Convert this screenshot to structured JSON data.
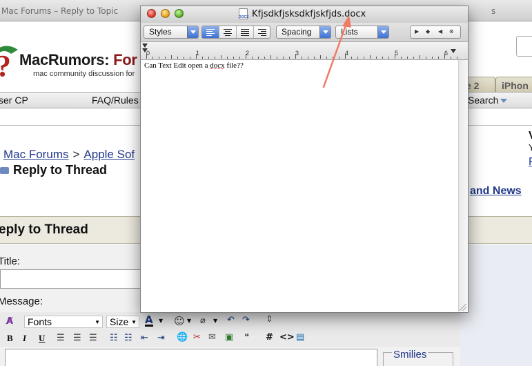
{
  "background": {
    "browser_title": "Mac Forums – Reply to Topic",
    "site": {
      "logo_main": "MacRumors:",
      "logo_accent": "For",
      "logo_tagline": "mac community discussion for"
    },
    "tabs": [
      "e 2",
      "iPhon"
    ],
    "navbar": {
      "user_cp": "ser CP",
      "faq_rules": "FAQ/Rules",
      "search": "Search"
    },
    "breadcrumb": {
      "link1": "Mac Forums",
      "separator": ">",
      "link2": "Apple Sof"
    },
    "reply_to_thread": "Reply to Thread",
    "right_link": "and News",
    "right_letters": [
      "V",
      "Y",
      "F"
    ],
    "section_title": "eply to Thread",
    "form": {
      "title_label": "Title:",
      "message_label": "Message:",
      "font_select": "Fonts",
      "size_select": "Size",
      "smilies_label": "Smilies"
    }
  },
  "textedit": {
    "window_title": "Kfjsdkfjsksdkfjskfjds.docx",
    "doc_icon_label": "DOCX",
    "toolbar": {
      "styles_label": "Styles",
      "spacing_label": "Spacing",
      "lists_label": "Lists"
    },
    "ruler_numbers": [
      "0",
      "1",
      "2",
      "3",
      "4",
      "5",
      "6"
    ],
    "document_text_before": "Can Text Edit open a ",
    "document_text_misspelled": "docx",
    "document_text_after": " file??"
  },
  "annotation": {
    "arrow_color": "#f07a64"
  }
}
